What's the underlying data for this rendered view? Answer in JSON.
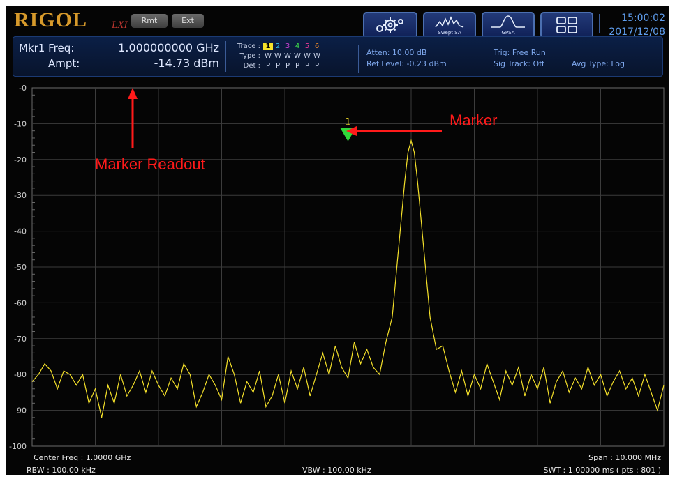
{
  "header": {
    "brand": "RIGOL",
    "brand_sub": "LXI",
    "chips": [
      "Rmt",
      "Ext"
    ],
    "buttons": [
      {
        "name": "settings-button",
        "icon": "gear-icon",
        "label": ""
      },
      {
        "name": "swept-sa-button",
        "icon": "swept-sa-icon",
        "label": "Swept SA"
      },
      {
        "name": "gpsa-button",
        "icon": "gpsa-icon",
        "label": "GPSA"
      },
      {
        "name": "layout-button",
        "icon": "layout-grid-icon",
        "label": ""
      }
    ],
    "time": "15:00:02",
    "date": "2017/12/08"
  },
  "marker_readout": {
    "freq_label": "Mkr1 Freq:",
    "freq_value": "1.000000000 GHz",
    "ampt_label": "Ampt:",
    "ampt_value": "-14.73 dBm"
  },
  "trace_table": {
    "trace_label": "Trace :",
    "type_label": "Type :",
    "det_label": "Det :",
    "traces": [
      {
        "num": "1",
        "type": "W",
        "det": "P",
        "color": "#f5e12a"
      },
      {
        "num": "2",
        "type": "W",
        "det": "P",
        "color": "#2fb9e6"
      },
      {
        "num": "3",
        "type": "W",
        "det": "P",
        "color": "#d143d6"
      },
      {
        "num": "4",
        "type": "W",
        "det": "P",
        "color": "#3fe04a"
      },
      {
        "num": "5",
        "type": "W",
        "det": "P",
        "color": "#ef3a9a"
      },
      {
        "num": "6",
        "type": "W",
        "det": "P",
        "color": "#f08a2a"
      }
    ]
  },
  "status": {
    "atten": "Atten: 10.00 dB",
    "ref_level": "Ref Level: -0.23 dBm",
    "trig": "Trig: Free Run",
    "sig_track": "Sig Track: Off",
    "avg_type": "Avg Type: Log"
  },
  "annotations": {
    "marker_readout": "Marker Readout",
    "marker": "Marker"
  },
  "footer": {
    "center_freq": "Center Freq : 1.0000 GHz",
    "span": "Span : 10.000 MHz",
    "rbw": "RBW : 100.00 kHz",
    "vbw": "VBW : 100.00 kHz",
    "swt": "SWT : 1.00000 ms ( pts : 801 )"
  },
  "chart_data": {
    "type": "line",
    "y_tick_labels": [
      "-0",
      "-10",
      "-20",
      "-30",
      "-40",
      "-50",
      "-60",
      "-70",
      "-80",
      "-90",
      "-100"
    ],
    "ylim": [
      -100,
      0
    ],
    "xlim": [
      995,
      1005
    ],
    "x_unit": "MHz",
    "y_unit": "dBm",
    "grid": true,
    "trace_color": "#f5e12a",
    "marker": {
      "label": "1",
      "x": 1000,
      "y": -14.73,
      "color": "#2fd83a"
    },
    "series": [
      {
        "values": [
          [
            995.0,
            -82
          ],
          [
            995.1,
            -80
          ],
          [
            995.2,
            -77
          ],
          [
            995.3,
            -79
          ],
          [
            995.4,
            -84
          ],
          [
            995.5,
            -79
          ],
          [
            995.6,
            -80
          ],
          [
            995.7,
            -83
          ],
          [
            995.8,
            -80
          ],
          [
            995.9,
            -88
          ],
          [
            996.0,
            -84
          ],
          [
            996.1,
            -92
          ],
          [
            996.2,
            -83
          ],
          [
            996.3,
            -88
          ],
          [
            996.4,
            -80
          ],
          [
            996.5,
            -86
          ],
          [
            996.6,
            -83
          ],
          [
            996.7,
            -79
          ],
          [
            996.8,
            -85
          ],
          [
            996.9,
            -79
          ],
          [
            997.0,
            -83
          ],
          [
            997.1,
            -86
          ],
          [
            997.2,
            -81
          ],
          [
            997.3,
            -84
          ],
          [
            997.4,
            -77
          ],
          [
            997.5,
            -80
          ],
          [
            997.6,
            -89
          ],
          [
            997.7,
            -85
          ],
          [
            997.8,
            -80
          ],
          [
            997.9,
            -83
          ],
          [
            998.0,
            -87
          ],
          [
            998.1,
            -75
          ],
          [
            998.2,
            -80
          ],
          [
            998.3,
            -88
          ],
          [
            998.4,
            -82
          ],
          [
            998.5,
            -85
          ],
          [
            998.6,
            -79
          ],
          [
            998.7,
            -89
          ],
          [
            998.8,
            -86
          ],
          [
            998.9,
            -80
          ],
          [
            999.0,
            -88
          ],
          [
            999.1,
            -79
          ],
          [
            999.2,
            -84
          ],
          [
            999.3,
            -78
          ],
          [
            999.4,
            -86
          ],
          [
            999.5,
            -80
          ],
          [
            999.6,
            -74
          ],
          [
            999.7,
            -80
          ],
          [
            999.8,
            -72
          ],
          [
            999.9,
            -78
          ],
          [
            1000.0,
            -81
          ],
          [
            1000.1,
            -71
          ],
          [
            1000.2,
            -77
          ],
          [
            1000.3,
            -73
          ],
          [
            1000.4,
            -78
          ],
          [
            1000.5,
            -80
          ],
          [
            1000.6,
            -71
          ],
          [
            1000.7,
            -64
          ],
          [
            1000.8,
            -45
          ],
          [
            1000.9,
            -26
          ],
          [
            1000.95,
            -18
          ],
          [
            1001.0,
            -14.73
          ],
          [
            1001.05,
            -18
          ],
          [
            1001.1,
            -26
          ],
          [
            1001.2,
            -45
          ],
          [
            1001.3,
            -64
          ],
          [
            1001.4,
            -73
          ],
          [
            1001.5,
            -72
          ],
          [
            1001.6,
            -79
          ],
          [
            1001.7,
            -85
          ],
          [
            1001.8,
            -79
          ],
          [
            1001.9,
            -86
          ],
          [
            1002.0,
            -80
          ],
          [
            1002.1,
            -84
          ],
          [
            1002.2,
            -77
          ],
          [
            1002.3,
            -82
          ],
          [
            1002.4,
            -87
          ],
          [
            1002.5,
            -79
          ],
          [
            1002.6,
            -83
          ],
          [
            1002.7,
            -78
          ],
          [
            1002.8,
            -86
          ],
          [
            1002.9,
            -80
          ],
          [
            1003.0,
            -84
          ],
          [
            1003.1,
            -78
          ],
          [
            1003.2,
            -88
          ],
          [
            1003.3,
            -82
          ],
          [
            1003.4,
            -79
          ],
          [
            1003.5,
            -85
          ],
          [
            1003.6,
            -81
          ],
          [
            1003.7,
            -84
          ],
          [
            1003.8,
            -78
          ],
          [
            1003.9,
            -83
          ],
          [
            1004.0,
            -80
          ],
          [
            1004.1,
            -86
          ],
          [
            1004.2,
            -82
          ],
          [
            1004.3,
            -79
          ],
          [
            1004.4,
            -84
          ],
          [
            1004.5,
            -81
          ],
          [
            1004.6,
            -86
          ],
          [
            1004.7,
            -80
          ],
          [
            1004.8,
            -85
          ],
          [
            1004.9,
            -90
          ],
          [
            1005.0,
            -83
          ]
        ]
      }
    ]
  }
}
